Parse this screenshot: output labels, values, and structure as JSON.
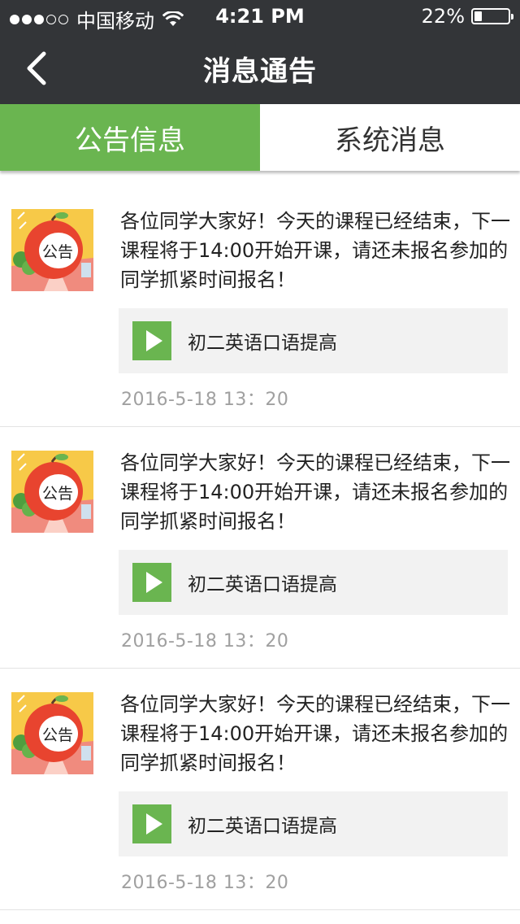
{
  "status_bar": {
    "signal_dots_filled": 3,
    "signal_dots_total": 5,
    "carrier": "中国移动",
    "wifi_icon": "wifi-icon",
    "time": "4:21 PM",
    "battery_percent": "22%",
    "battery_level": 0.22
  },
  "nav": {
    "back_icon": "chevron-left-icon",
    "title": "消息通告"
  },
  "tabs": [
    {
      "label": "公告信息",
      "active": true
    },
    {
      "label": "系统消息",
      "active": false
    }
  ],
  "announcements": [
    {
      "avatar_label": "公告",
      "text": "各位同学大家好！今天的课程已经结束，下一课程将于14:00开始开课，请还未报名参加的同学抓紧时间报名！",
      "course_name": "初二英语口语提高",
      "timestamp": "2016-5-18  13：20"
    },
    {
      "avatar_label": "公告",
      "text": "各位同学大家好！今天的课程已经结束，下一课程将于14:00开始开课，请还未报名参加的同学抓紧时间报名！",
      "course_name": "初二英语口语提高",
      "timestamp": "2016-5-18  13：20"
    },
    {
      "avatar_label": "公告",
      "text": "各位同学大家好！今天的课程已经结束，下一课程将于14:00开始开课，请还未报名参加的同学抓紧时间报名！",
      "course_name": "初二英语口语提高",
      "timestamp": "2016-5-18  13：20"
    }
  ],
  "colors": {
    "bar_background": "#333538",
    "accent_green": "#6ab550",
    "course_background": "#f2f2f2",
    "timestamp_text": "#a0a0a0"
  }
}
